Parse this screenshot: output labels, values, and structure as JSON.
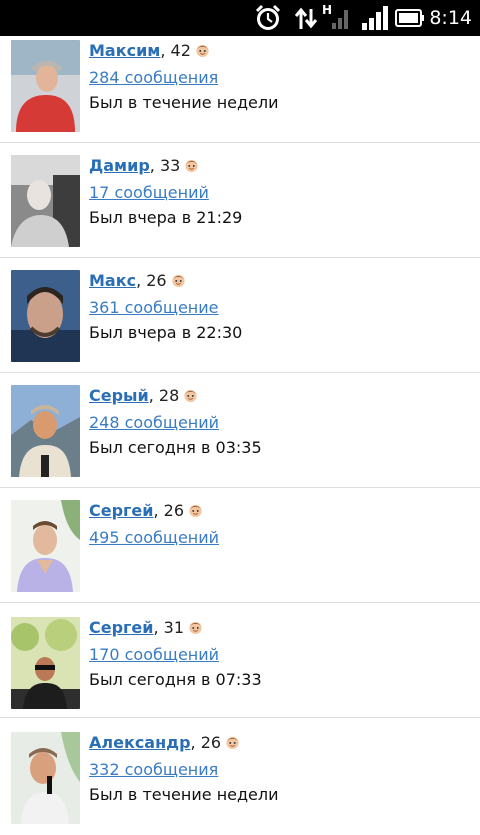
{
  "status_bar": {
    "time": "8:14",
    "network_type": "H",
    "icons": [
      "alarm-icon",
      "data-transfer-icon",
      "signal-icon",
      "battery-icon"
    ]
  },
  "users": [
    {
      "name": "Максим",
      "age_text": ", 42",
      "messages": "284 сообщения",
      "last_seen": "Был в течение недели"
    },
    {
      "name": "Дамир",
      "age_text": ", 33",
      "messages": "17 сообщений",
      "last_seen": "Был вчера в 21:29"
    },
    {
      "name": "Макс",
      "age_text": ", 26",
      "messages": "361 сообщение",
      "last_seen": "Был вчера в 22:30"
    },
    {
      "name": "Серый",
      "age_text": ", 28",
      "messages": "248 сообщений",
      "last_seen": "Был сегодня в 03:35"
    },
    {
      "name": "Сергей",
      "age_text": ", 26",
      "messages": "495 сообщений",
      "last_seen": ""
    },
    {
      "name": "Сергей",
      "age_text": ", 31",
      "messages": "170 сообщений",
      "last_seen": "Был сегодня в 07:33"
    },
    {
      "name": "Александр",
      "age_text": ", 26",
      "messages": "332 сообщения",
      "last_seen": "Был в течение недели"
    }
  ],
  "colors": {
    "link": "#2a6fb6",
    "status_bar": "#000000",
    "divider": "#dddddd"
  }
}
